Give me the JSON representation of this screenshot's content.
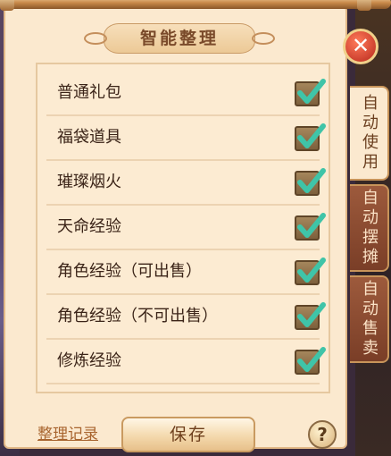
{
  "title": "智能整理",
  "items": [
    {
      "label": "普通礼包",
      "checked": true
    },
    {
      "label": "福袋道具",
      "checked": true
    },
    {
      "label": "璀璨烟火",
      "checked": true
    },
    {
      "label": "天命经验",
      "checked": true
    },
    {
      "label": "角色经验（可出售）",
      "checked": true
    },
    {
      "label": "角色经验（不可出售）",
      "checked": true
    },
    {
      "label": "修炼经验",
      "checked": true
    }
  ],
  "footer": {
    "record_link": "整理记录",
    "save_label": "保存",
    "help_label": "?"
  },
  "close_label": "✕",
  "tabs": [
    {
      "label": "自动使用",
      "active": true
    },
    {
      "label": "自动摆摊",
      "active": false
    },
    {
      "label": "自动售卖",
      "active": false
    }
  ],
  "colors": {
    "panel": "#fbe9cf",
    "check": "#3fc4a8",
    "tab_inactive": "#8a4a30"
  }
}
